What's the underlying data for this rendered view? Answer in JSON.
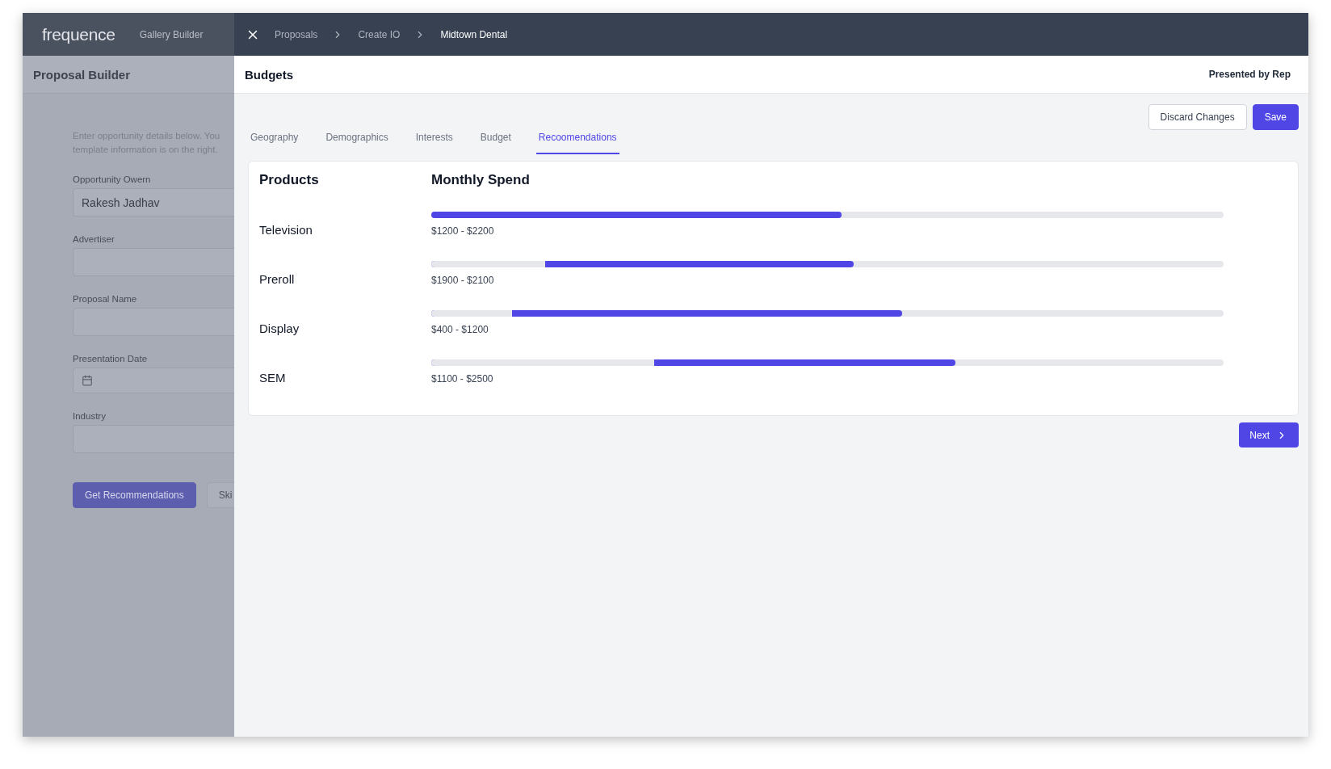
{
  "app": {
    "logo": "frequence",
    "nav": [
      "Gallery Builder"
    ]
  },
  "left_panel": {
    "title": "Proposal Builder",
    "intro": [
      "Enter opportunity details below. You",
      "template information is on the right."
    ],
    "fields": [
      {
        "kind": "text",
        "label": "Opportunity Owern",
        "value": "Rakesh Jadhav"
      },
      {
        "kind": "text",
        "label": "Advertiser"
      },
      {
        "kind": "text",
        "label": "Proposal Name"
      },
      {
        "kind": "date",
        "label": "Presentation Date"
      },
      {
        "kind": "text",
        "label": "Industry"
      }
    ],
    "buttons": [
      {
        "label": "Get Recommendations",
        "primary": true
      },
      {
        "label": "Ski",
        "primary": false
      }
    ]
  },
  "breadcrumbs": [
    "Proposals",
    "Create IO",
    "Midtown Dental"
  ],
  "drawer": {
    "title": "Budgets",
    "presenter": "Presented by Rep",
    "actions": [
      {
        "label": "Discard Changes",
        "primary": false
      },
      {
        "label": "Save",
        "primary": true
      }
    ],
    "tabs": [
      {
        "label": "Geography",
        "selected": false
      },
      {
        "label": "Demographics",
        "selected": false
      },
      {
        "label": "Interests",
        "selected": false
      },
      {
        "label": "Budget",
        "selected": false
      },
      {
        "label": "Recoomendations",
        "selected": true
      }
    ],
    "columns": [
      "Products",
      "Monthly Spend"
    ],
    "products": [
      {
        "name": "Television",
        "max": {
          "level": 0.518
        },
        "range": "$1200 - $2200"
      },
      {
        "name": "Preroll",
        "min": {
          "level": 0.144
        },
        "max": {
          "level": 0.533
        },
        "range": "$1900 - $2100"
      },
      {
        "name": "Display",
        "min": {
          "level": 0.102
        },
        "max": {
          "level": 0.594
        },
        "range": "$400 - $1200"
      },
      {
        "name": "SEM",
        "min": {
          "level": 0.281
        },
        "max": {
          "level": 0.662
        },
        "range": "$1100 - $2500"
      }
    ],
    "next": "Next"
  }
}
